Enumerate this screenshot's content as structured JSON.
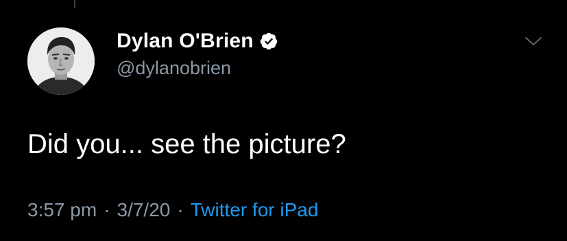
{
  "tweet": {
    "author": {
      "display_name": "Dylan O'Brien",
      "handle": "@dylanobrien",
      "verified": true,
      "verified_icon": "verified-badge-icon"
    },
    "text": "Did you... see the picture?",
    "time": "3:57 pm",
    "date": "3/7/20",
    "separator": "·",
    "source": "Twitter for iPad"
  },
  "icons": {
    "more": "chevron-down-icon",
    "avatar": "profile-photo"
  },
  "colors": {
    "background": "#000000",
    "name": "#ffffff",
    "secondary": "#8b98a5",
    "link": "#1d9bf0"
  }
}
